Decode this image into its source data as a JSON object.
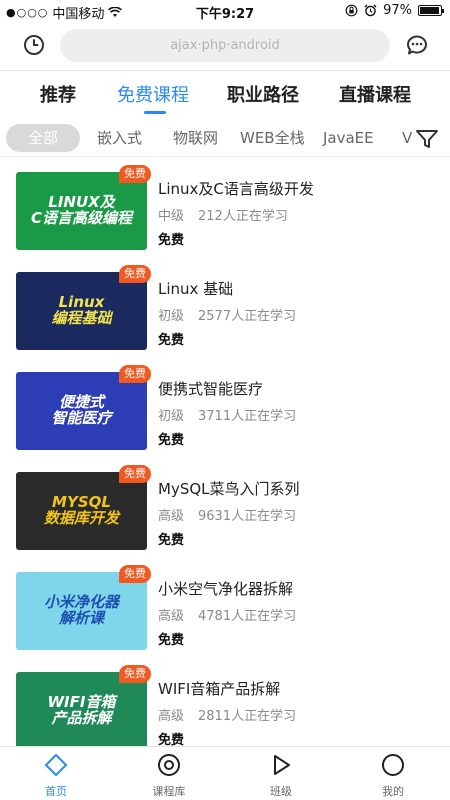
{
  "status_bar": {
    "signal_dots": "●○○○",
    "carrier": "中国移动",
    "time": "下午9:27",
    "battery": "97%",
    "battery_level": 0.97
  },
  "header": {
    "history_icon": "clock-icon",
    "search_placeholder": "ajax·php·android",
    "message_icon": "chat-bubble-icon"
  },
  "tabs": [
    {
      "label": "推荐",
      "active": false
    },
    {
      "label": "免费课程",
      "active": true
    },
    {
      "label": "职业路径",
      "active": false
    },
    {
      "label": "直播课程",
      "active": false
    }
  ],
  "categories": [
    {
      "label": "全部",
      "active": true
    },
    {
      "label": "嵌入式",
      "active": false
    },
    {
      "label": "物联网",
      "active": false
    },
    {
      "label": "WEB全栈",
      "active": false
    },
    {
      "label": "JavaEE",
      "active": false
    },
    {
      "label": "V",
      "active": false
    }
  ],
  "filter_icon": "filter-funnel-icon",
  "courses": [
    {
      "badge": "免费",
      "title": "Linux及C语言高级开发",
      "level": "中级",
      "learners": "212人正在学习",
      "price": "免费",
      "thumb_text": "LINUX及\nC语言高级编程",
      "thumb_bg": "#1a9a47",
      "thumb_color": "#ffffff"
    },
    {
      "badge": "免费",
      "title": "Linux 基础",
      "level": "初级",
      "learners": "2577人正在学习",
      "price": "免费",
      "thumb_text": "Linux\n编程基础",
      "thumb_bg": "#1b2a5e",
      "thumb_color": "#f2e34a"
    },
    {
      "badge": "免费",
      "title": "便携式智能医疗",
      "level": "初级",
      "learners": "3711人正在学习",
      "price": "免费",
      "thumb_text": "便捷式\n智能医疗",
      "thumb_bg": "#2d3db5",
      "thumb_color": "#ffffff"
    },
    {
      "badge": "免费",
      "title": "MySQL菜鸟入门系列",
      "level": "高级",
      "learners": "9631人正在学习",
      "price": "免费",
      "thumb_text": "MYSQL\n数据库开发",
      "thumb_bg": "#2a2a2a",
      "thumb_color": "#f2c41a"
    },
    {
      "badge": "免费",
      "title": "小米空气净化器拆解",
      "level": "高级",
      "learners": "4781人正在学习",
      "price": "免费",
      "thumb_text": "小米净化器\n解析课",
      "thumb_bg": "#7fd5ea",
      "thumb_color": "#1d4fb0"
    },
    {
      "badge": "免费",
      "title": "WIFI音箱产品拆解",
      "level": "高级",
      "learners": "2811人正在学习",
      "price": "免费",
      "thumb_text": "WIFI音箱\n产品拆解",
      "thumb_bg": "#1f8a58",
      "thumb_color": "#ffffff"
    }
  ],
  "bottom_tabs": [
    {
      "label": "首页",
      "icon": "home-diamond-icon",
      "active": true
    },
    {
      "label": "课程库",
      "icon": "target-circle-icon",
      "active": false
    },
    {
      "label": "班级",
      "icon": "play-triangle-icon",
      "active": false
    },
    {
      "label": "我的",
      "icon": "profile-circle-icon",
      "active": false
    }
  ],
  "colors": {
    "accent": "#2b8bf2",
    "badge": "#f05a22"
  }
}
